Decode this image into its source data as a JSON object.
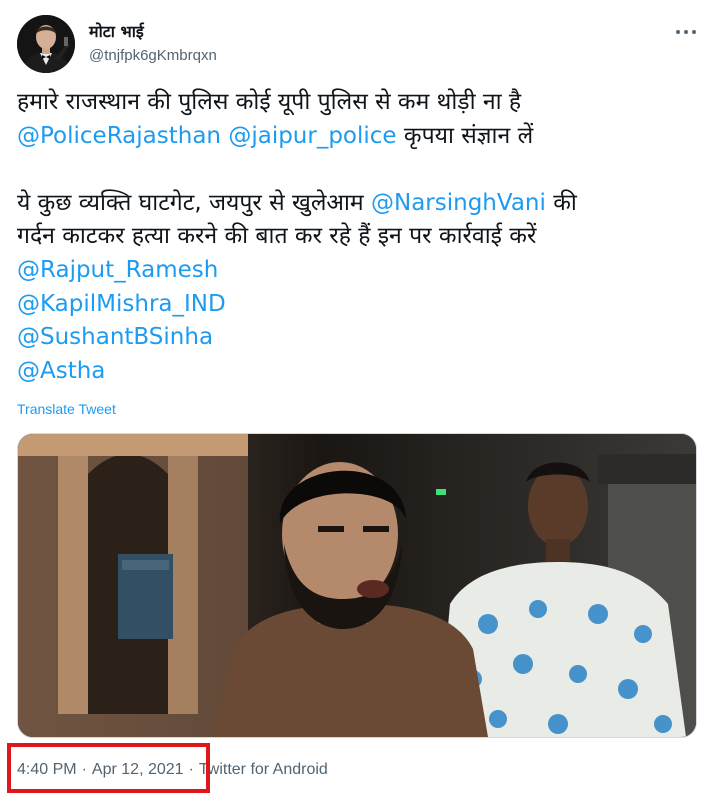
{
  "tweet": {
    "author_name": "मोटा भाई",
    "author_handle": "@tnjfpk6gKmbrqxn",
    "more_icon": "more-horizontal-icon",
    "lines": [
      {
        "text": "हमारे राजस्थान की पुलिस कोई यूपी पुलिस से कम थोड़ी ना है"
      },
      {
        "mention1": "@PoliceRajasthan",
        "mention2": "@jaipur_police",
        "text": " कृपया संज्ञान लें"
      },
      {
        "text_before": "ये कुछ व्यक्ति घाटगेट, जयपुर से खुलेआम ",
        "mention": "@NarsinghVani",
        "text_after": " की"
      },
      {
        "text": "गर्दन काटकर हत्या करने की बात कर रहे हैं इन पर कार्रवाई करें"
      }
    ],
    "mentions": [
      "@Rajput_Ramesh",
      "@KapilMishra_IND",
      "@SushantBSinha",
      "@Astha"
    ],
    "translate_label": "Translate Tweet",
    "time": "4:40 PM",
    "separator": "·",
    "date": "Apr 12, 2021",
    "source": "Twitter for Android"
  },
  "colors": {
    "link": "#1d9bf0",
    "text": "#0f1419",
    "secondary": "#536471",
    "highlight": "#e0161d"
  }
}
